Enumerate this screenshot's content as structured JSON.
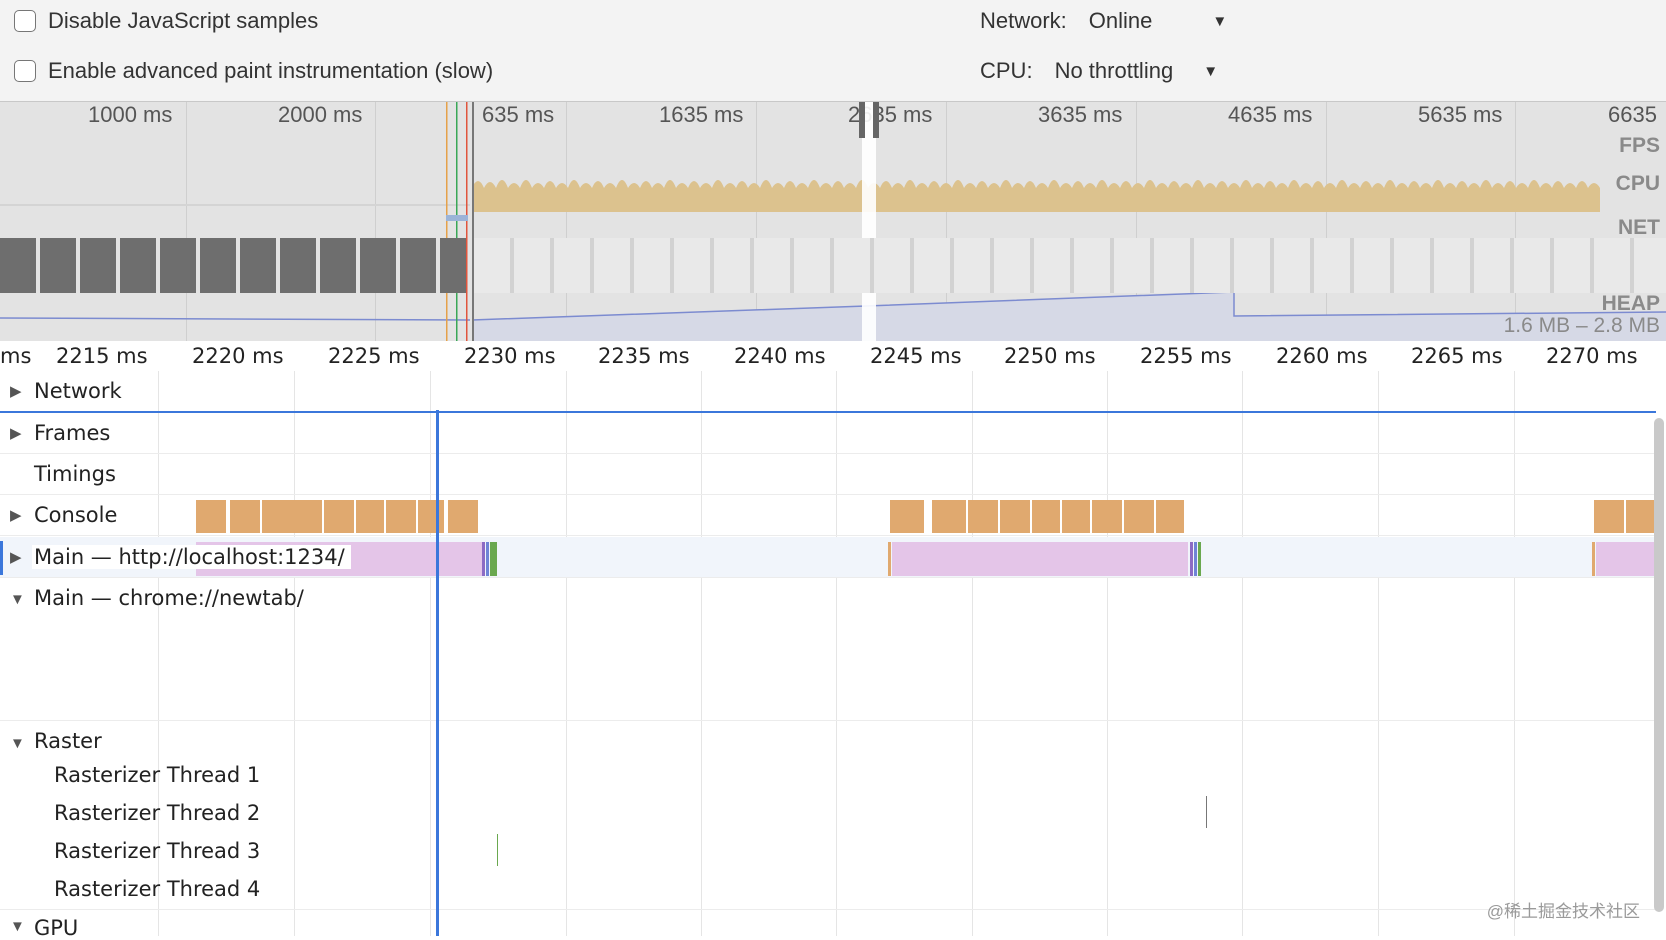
{
  "settings": {
    "disable_js_samples": "Disable JavaScript samples",
    "advanced_paint": "Enable advanced paint instrumentation (slow)",
    "network_label": "Network:",
    "network_value": "Online",
    "cpu_label": "CPU:",
    "cpu_value": "No throttling"
  },
  "overview": {
    "ticks": [
      "1000 ms",
      "2000 ms",
      "635 ms",
      "1635 ms",
      "2635 ms",
      "3635 ms",
      "4635 ms",
      "5635 ms",
      "6635"
    ],
    "tracks": {
      "fps": "FPS",
      "cpu": "CPU",
      "net": "NET",
      "heap": "HEAP"
    },
    "heap_range": "1.6 MB – 2.8 MB"
  },
  "ruler": {
    "ticks": [
      "ms",
      "2215 ms",
      "2220 ms",
      "2225 ms",
      "2230 ms",
      "2235 ms",
      "2240 ms",
      "2245 ms",
      "2250 ms",
      "2255 ms",
      "2260 ms",
      "2265 ms",
      "2270 ms"
    ]
  },
  "tracks": {
    "network": "Network",
    "frames": "Frames",
    "timings": "Timings",
    "console": "Console",
    "main_localhost": "Main — http://localhost:1234/",
    "main_newtab": "Main — chrome://newtab/",
    "raster": "Raster",
    "raster_threads": [
      "Rasterizer Thread 1",
      "Rasterizer Thread 2",
      "Rasterizer Thread 3",
      "Rasterizer Thread 4"
    ],
    "gpu": "GPU"
  },
  "watermark": "@稀土掘金技术社区",
  "colors": {
    "scripting": "#e0a96f",
    "main_task": "#e4c5e8",
    "cpu_scripting": "#dcc28e",
    "selection": "#3b77db"
  },
  "icons": [
    "checkbox-icon",
    "dropdown-arrow-icon",
    "expand-triangle-icon",
    "collapse-triangle-icon"
  ]
}
